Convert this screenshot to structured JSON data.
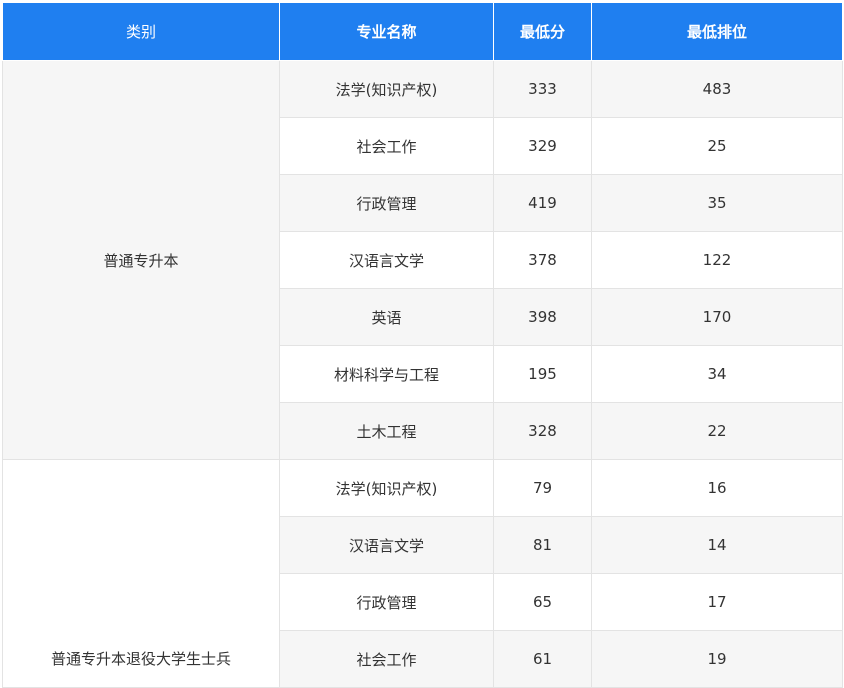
{
  "headers": [
    "类别",
    "专业名称",
    "最低分",
    "最低排位"
  ],
  "groups": [
    {
      "category": "普通专升本",
      "rows": [
        {
          "major": "法学(知识产权)",
          "min_score": "333",
          "min_rank": "483"
        },
        {
          "major": "社会工作",
          "min_score": "329",
          "min_rank": "25"
        },
        {
          "major": "行政管理",
          "min_score": "419",
          "min_rank": "35"
        },
        {
          "major": "汉语言文学",
          "min_score": "378",
          "min_rank": "122"
        },
        {
          "major": "英语",
          "min_score": "398",
          "min_rank": "170"
        },
        {
          "major": "材料科学与工程",
          "min_score": "195",
          "min_rank": "34"
        },
        {
          "major": "土木工程",
          "min_score": "328",
          "min_rank": "22"
        }
      ]
    },
    {
      "category": "普通专升本退役大学生士兵",
      "rows": [
        {
          "major": "法学(知识产权)",
          "min_score": "79",
          "min_rank": "16"
        },
        {
          "major": "汉语言文学",
          "min_score": "81",
          "min_rank": "14"
        },
        {
          "major": "行政管理",
          "min_score": "65",
          "min_rank": "17"
        },
        {
          "major": "社会工作",
          "min_score": "61",
          "min_rank": "19"
        }
      ]
    }
  ]
}
